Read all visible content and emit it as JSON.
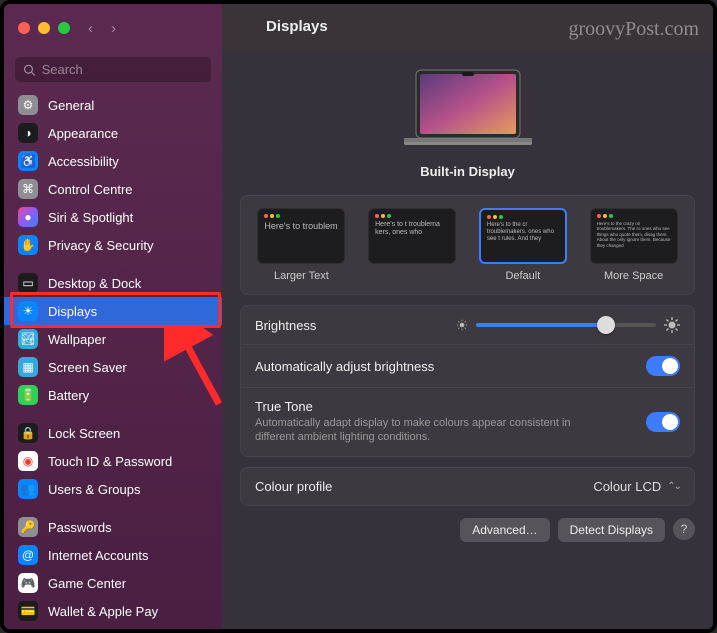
{
  "watermark": "groovyPost.com",
  "title": "Displays",
  "search": {
    "placeholder": "Search"
  },
  "sidebar": {
    "items": [
      {
        "label": "General",
        "icon": "gear-icon",
        "bg": "#8e8e93"
      },
      {
        "label": "Appearance",
        "icon": "appearance-icon",
        "bg": "#1c1c1e"
      },
      {
        "label": "Accessibility",
        "icon": "accessibility-icon",
        "bg": "#0a84ff"
      },
      {
        "label": "Control Centre",
        "icon": "control-centre-icon",
        "bg": "#8e8e93"
      },
      {
        "label": "Siri & Spotlight",
        "icon": "siri-icon",
        "bg": "#1c1c1e"
      },
      {
        "label": "Privacy & Security",
        "icon": "privacy-icon",
        "bg": "#0a84ff"
      },
      {
        "label": "Desktop & Dock",
        "icon": "desktop-dock-icon",
        "bg": "#1c1c1e"
      },
      {
        "label": "Displays",
        "icon": "displays-icon",
        "bg": "#0a84ff",
        "selected": true
      },
      {
        "label": "Wallpaper",
        "icon": "wallpaper-icon",
        "bg": "#34aadc"
      },
      {
        "label": "Screen Saver",
        "icon": "screen-saver-icon",
        "bg": "#34aadc"
      },
      {
        "label": "Battery",
        "icon": "battery-icon",
        "bg": "#30d158"
      },
      {
        "label": "Lock Screen",
        "icon": "lock-screen-icon",
        "bg": "#1c1c1e"
      },
      {
        "label": "Touch ID & Password",
        "icon": "touch-id-icon",
        "bg": "#ffffff"
      },
      {
        "label": "Users & Groups",
        "icon": "users-groups-icon",
        "bg": "#0a84ff"
      },
      {
        "label": "Passwords",
        "icon": "passwords-icon",
        "bg": "#8e8e93"
      },
      {
        "label": "Internet Accounts",
        "icon": "internet-accounts-icon",
        "bg": "#0a84ff"
      },
      {
        "label": "Game Center",
        "icon": "game-center-icon",
        "bg": "#ffffff"
      },
      {
        "label": "Wallet & Apple Pay",
        "icon": "wallet-icon",
        "bg": "#1c1c1e"
      }
    ]
  },
  "main": {
    "preview_title": "Built-in Display",
    "resolutions": [
      {
        "label": "Larger Text"
      },
      {
        "label": ""
      },
      {
        "label": "Default",
        "selected": true
      },
      {
        "label": "More Space"
      }
    ],
    "thumb_text_large": "Here's to troublem",
    "thumb_text_med": "Here's to t troublema kers, ones who",
    "thumb_text_default": "Here's to the cr troublemakers. ones who see t rules. And they",
    "thumb_text_small": "Here's to the crazy on troublemakers. The ro ones who see things who quote them, disag them. About the only ignore them. Because they changed",
    "brightness_label": "Brightness",
    "auto_brightness_label": "Automatically adjust brightness",
    "true_tone_label": "True Tone",
    "true_tone_sub": "Automatically adapt display to make colours appear consistent in different ambient lighting conditions.",
    "colour_profile_label": "Colour profile",
    "colour_profile_value": "Colour LCD",
    "advanced_label": "Advanced…",
    "detect_label": "Detect Displays",
    "help_label": "?"
  }
}
